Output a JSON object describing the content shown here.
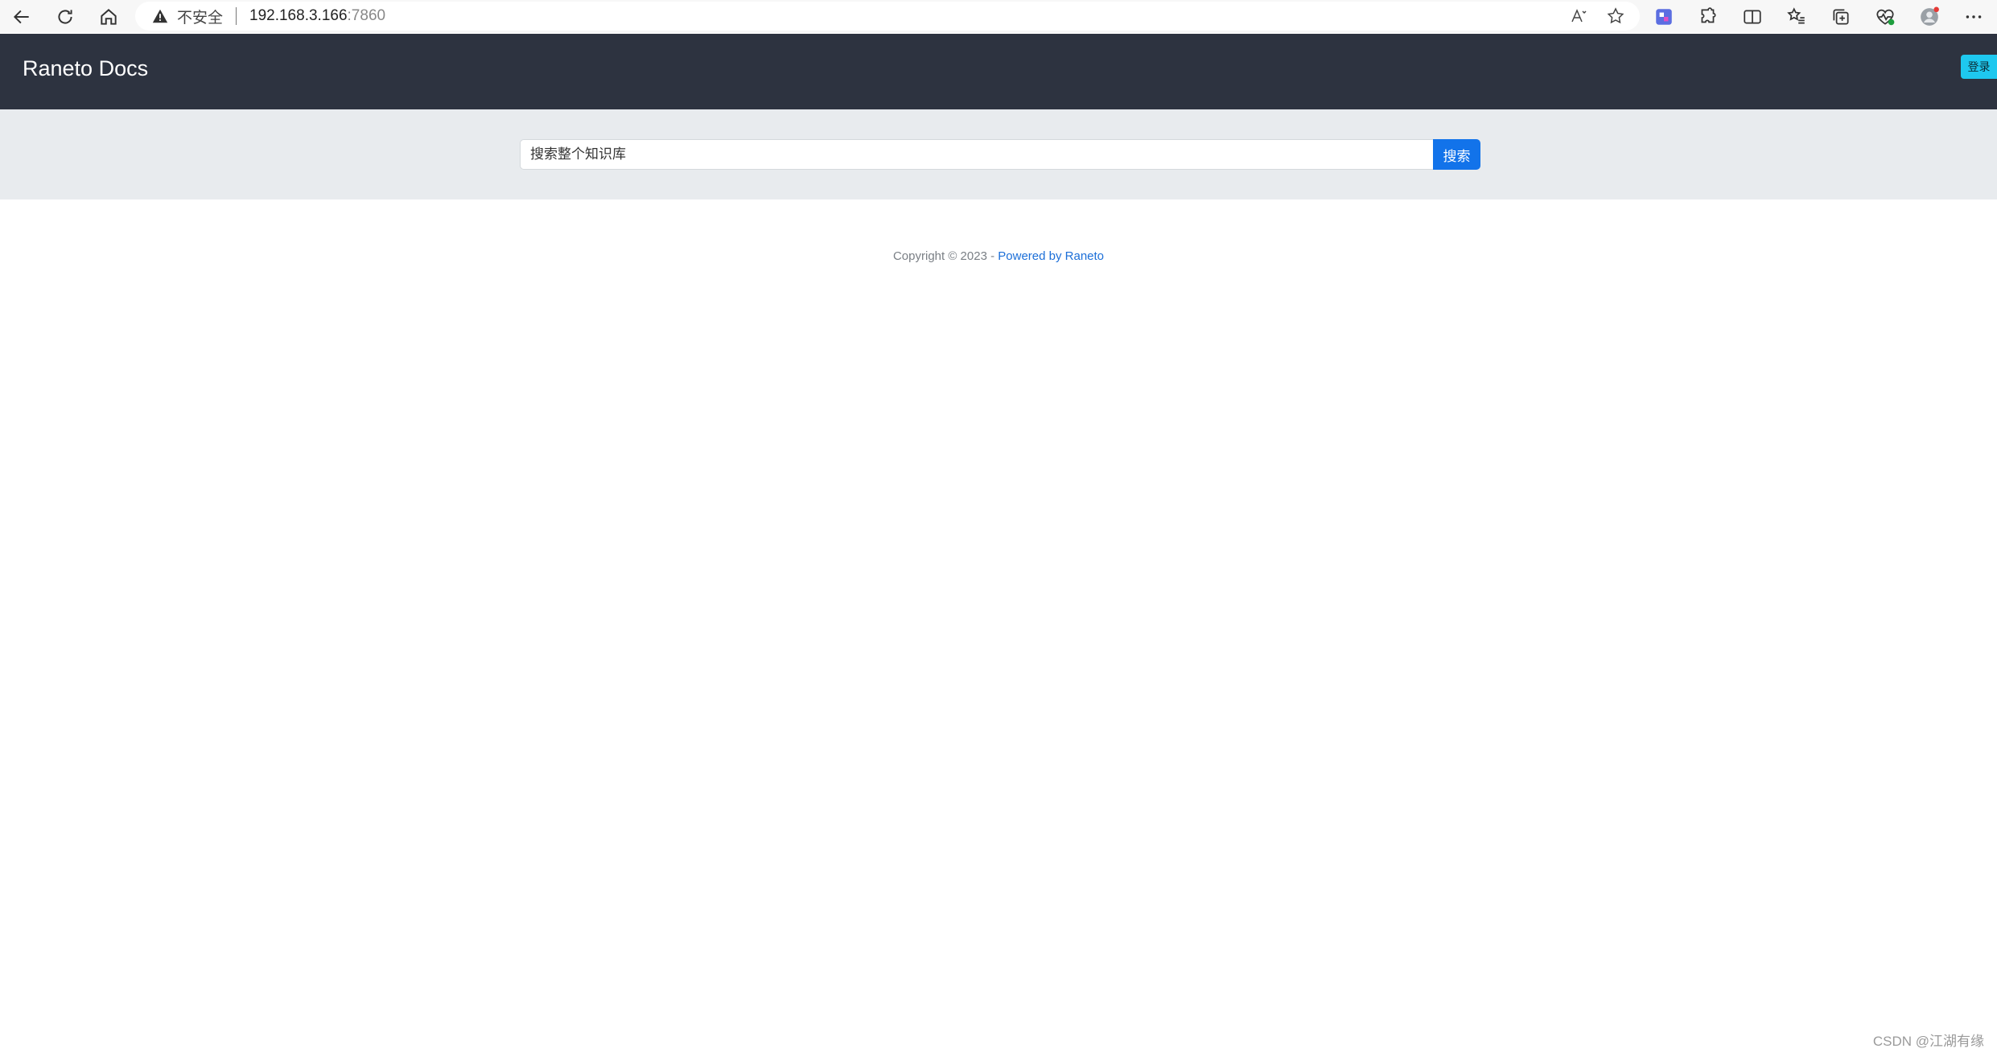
{
  "browser": {
    "security_label": "不安全",
    "url_host": "192.168.3.166",
    "url_port": ":7860",
    "colors": {
      "favorite_tile": "#5b6ee1",
      "notification_dot": "#e53935",
      "health_badge": "#1e9e3e"
    }
  },
  "header": {
    "site_title": "Raneto Docs",
    "login_label": "登录",
    "colors": {
      "background": "#2d3340",
      "login_button": "#1ec8ef"
    }
  },
  "search": {
    "placeholder": "搜索整个知识库",
    "button_label": "搜索",
    "colors": {
      "band": "#e8ebee",
      "button": "#1273ea"
    }
  },
  "footer": {
    "copyright": "Copyright © 2023 - ",
    "powered_by": "Powered by Raneto",
    "link_color": "#1c6fd8"
  },
  "watermark": {
    "text": "CSDN @江湖有缘"
  }
}
